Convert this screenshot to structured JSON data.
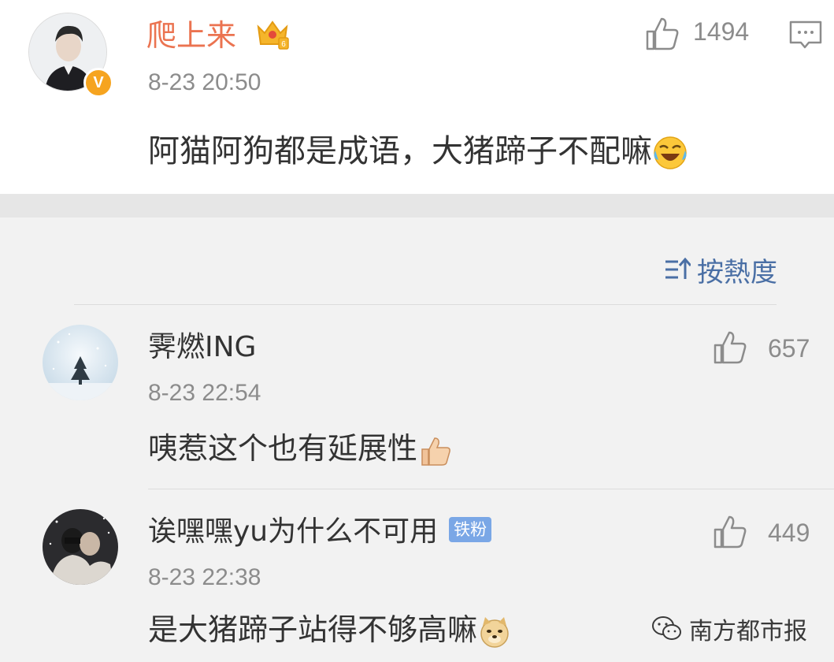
{
  "post": {
    "username": "爬上来",
    "time": "8-23 20:50",
    "like_count": "1494",
    "text": "阿猫阿狗都是成语，大猪蹄子不配嘛",
    "emoji": "laughing-crying-emoji",
    "verified_badge": "V"
  },
  "sort": {
    "label": "按熱度"
  },
  "comments": [
    {
      "username": "霁燃ING",
      "time": "8-23 22:54",
      "text": "咦惹这个也有延展性",
      "emoji": "thumbs-up-emoji",
      "like_count": "657"
    },
    {
      "username": "诶嘿嘿yu为什么不可用",
      "badge": "铁粉",
      "time": "8-23 22:38",
      "text": "是大猪蹄子站得不够高嘛",
      "emoji": "doge-emoji",
      "like_count": "449"
    }
  ],
  "watermark": {
    "text": "南方都市报",
    "icon": "wechat-icon"
  },
  "colors": {
    "username_orange": "#eb7350",
    "sort_blue": "#4a6fa5",
    "badge_blue": "#7aa7e6",
    "verified_gold": "#f6a41f"
  }
}
